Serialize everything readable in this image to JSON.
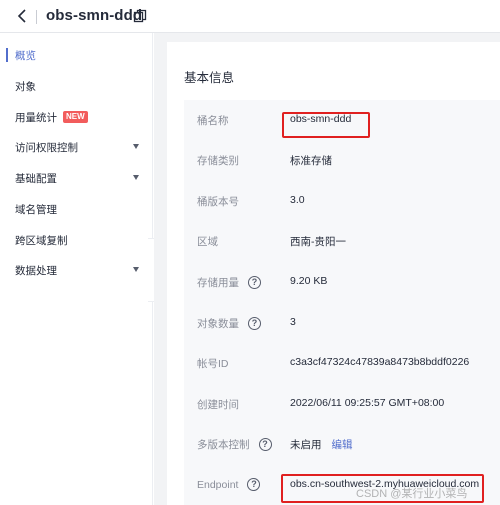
{
  "header": {
    "bucket_name": "obs-smn-ddd"
  },
  "sidebar": {
    "items": [
      {
        "label": "概览",
        "active": true
      },
      {
        "label": "对象"
      },
      {
        "label": "用量统计",
        "badge": "NEW"
      },
      {
        "label": "访问权限控制",
        "expandable": true
      },
      {
        "label": "基础配置",
        "expandable": true
      },
      {
        "label": "域名管理"
      },
      {
        "label": "跨区域复制"
      },
      {
        "label": "数据处理",
        "expandable": true
      }
    ]
  },
  "main": {
    "section_title": "基本信息",
    "fields": [
      {
        "label": "桶名称",
        "value": "obs-smn-ddd"
      },
      {
        "label": "存储类别",
        "value": "标准存储"
      },
      {
        "label": "桶版本号",
        "value": "3.0"
      },
      {
        "label": "区域",
        "value": "西南-贵阳一"
      },
      {
        "label": "存储用量",
        "value": "9.20 KB"
      },
      {
        "label": "对象数量",
        "value": "3"
      },
      {
        "label": "帐号ID",
        "value": "c3a3cf47324c47839a8473b8bddf0226"
      },
      {
        "label": "创建时间",
        "value": "2022/06/11 09:25:57 GMT+08:00"
      },
      {
        "label": "多版本控制",
        "value": "未启用",
        "action": "编辑"
      },
      {
        "label": "Endpoint",
        "value": "obs.cn-southwest-2.myhuaweicloud.com"
      }
    ]
  },
  "watermark": "CSDN @某行业小菜鸟"
}
